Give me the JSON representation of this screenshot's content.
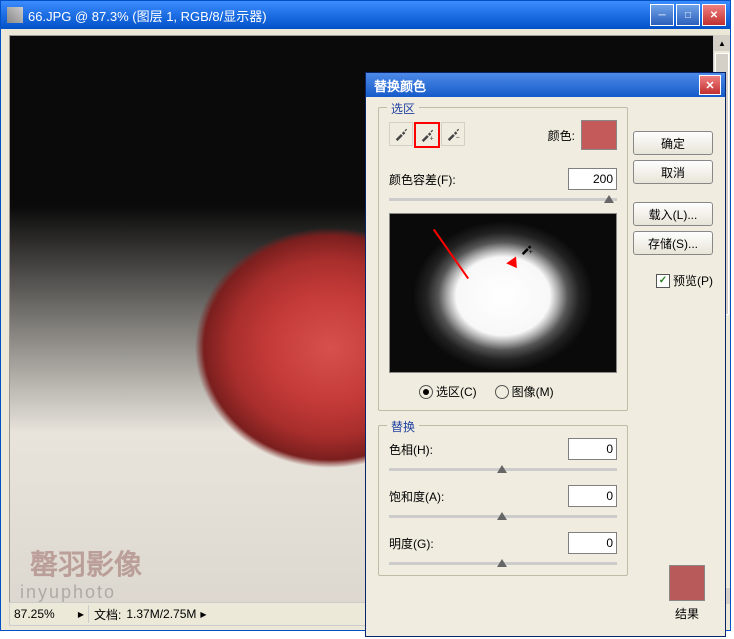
{
  "mainWindow": {
    "title": "66.JPG @ 87.3% (图层 1, RGB/8/显示器)",
    "zoom": "87.25%",
    "docLabel": "文档:",
    "docSize": "1.37M/2.75M",
    "watermark1": "罄羽影像",
    "watermark2": "inyuphoto"
  },
  "dialog": {
    "title": "替换颜色",
    "groups": {
      "selection": "选区",
      "replace": "替换"
    },
    "colorLabel": "颜色:",
    "fuzzinessLabel": "颜色容差(F):",
    "fuzziness": "200",
    "radios": {
      "selection": "选区(C)",
      "image": "图像(M)"
    },
    "hueLabel": "色相(H):",
    "hue": "0",
    "satLabel": "饱和度(A):",
    "sat": "0",
    "lightLabel": "明度(G):",
    "light": "0",
    "resultLabel": "结果",
    "buttons": {
      "ok": "确定",
      "cancel": "取消",
      "load": "载入(L)...",
      "save": "存储(S)..."
    },
    "previewCheckbox": "预览(P)"
  },
  "colors": {
    "sampleColor": "#C55A5A",
    "resultColor": "#B85A5A"
  }
}
